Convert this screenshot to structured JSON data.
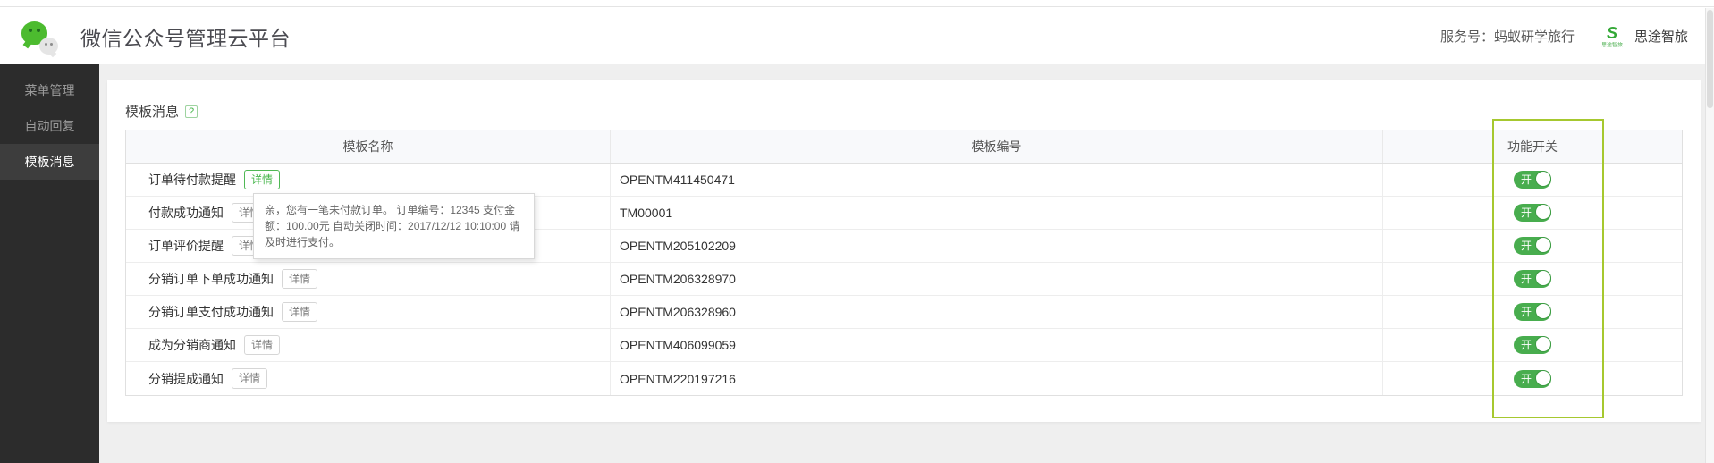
{
  "header": {
    "title": "微信公众号管理云平台",
    "service_account_label": "服务号：蚂蚁研学旅行",
    "brand_logo_glyph": "S",
    "brand_logo_subtext": "思途智旅",
    "brand_name": "思途智旅"
  },
  "sidebar": {
    "items": [
      {
        "label": "菜单管理"
      },
      {
        "label": "自动回复"
      },
      {
        "label": "模板消息"
      }
    ]
  },
  "main": {
    "section_title": "模板消息",
    "help_icon_glyph": "?",
    "table": {
      "columns": [
        "模板名称",
        "模板编号",
        "功能开关"
      ],
      "detail_label": "详情",
      "toggle_on_label": "开",
      "rows": [
        {
          "name": "订单待付款提醒",
          "code": "OPENTM411450471",
          "enabled": true
        },
        {
          "name": "付款成功通知",
          "code": "TM00001",
          "enabled": true
        },
        {
          "name": "订单评价提醒",
          "code": "OPENTM205102209",
          "enabled": true
        },
        {
          "name": "分销订单下单成功通知",
          "code": "OPENTM206328970",
          "enabled": true
        },
        {
          "name": "分销订单支付成功通知",
          "code": "OPENTM206328960",
          "enabled": true
        },
        {
          "name": "成为分销商通知",
          "code": "OPENTM406099059",
          "enabled": true
        },
        {
          "name": "分销提成通知",
          "code": "OPENTM220197216",
          "enabled": true
        }
      ]
    },
    "tooltip": {
      "text": "亲，您有一笔未付款订单。 订单编号：12345 支付金额：100.00元 自动关闭时间：2017/12/12 10:10:00 请及时进行支付。"
    }
  },
  "colors": {
    "wechat_green": "#44b549",
    "toggle_green": "#48ad4e",
    "annotation_green": "#a6c82f",
    "sidebar_bg": "#2c2c2c",
    "sidebar_active_bg": "#3d3d3d",
    "page_bg": "#efefef"
  }
}
